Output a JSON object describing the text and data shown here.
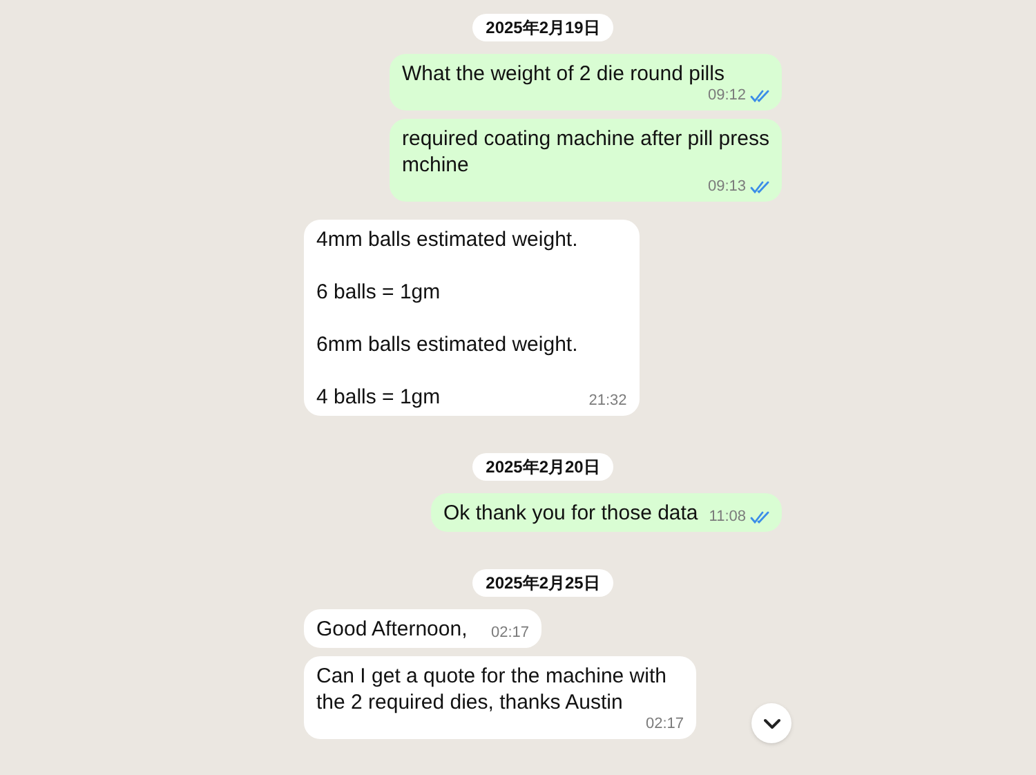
{
  "items": [
    {
      "kind": "date",
      "text": "2025年2月19日"
    },
    {
      "kind": "outgoing",
      "text": "What the weight of 2 die round pills",
      "time": "09:12",
      "read": true
    },
    {
      "kind": "outgoing",
      "text": "required coating machine after pill press mchine",
      "time": "09:13",
      "read": true
    },
    {
      "kind": "incoming",
      "text": "4mm balls estimated weight.\n\n6 balls = 1gm\n\n6mm balls estimated weight.\n\n4 balls = 1gm",
      "time": "21:32"
    },
    {
      "kind": "date",
      "text": "2025年2月20日"
    },
    {
      "kind": "outgoing",
      "text": "Ok thank you for those data",
      "time": "11:08",
      "read": true
    },
    {
      "kind": "date",
      "text": "2025年2月25日"
    },
    {
      "kind": "incoming",
      "text": "Good Afternoon,",
      "time": "02:17"
    },
    {
      "kind": "incoming",
      "text": "Can I get a quote for the machine with the 2 required dies, thanks Austin",
      "time": "02:17"
    }
  ]
}
